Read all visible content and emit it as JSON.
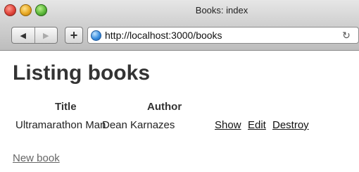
{
  "window": {
    "title": "Books: index"
  },
  "toolbar": {
    "back_icon": "back-arrow-icon",
    "forward_icon": "forward-arrow-icon",
    "add_label": "+",
    "url": "http://localhost:3000/books",
    "reload_icon": "reload-icon"
  },
  "page": {
    "heading": "Listing books",
    "table": {
      "headers": [
        "Title",
        "Author"
      ],
      "rows": [
        {
          "title": "Ultramarathon Man",
          "author": "Dean Karnazes",
          "actions": [
            "Show",
            "Edit",
            "Destroy"
          ]
        }
      ]
    },
    "new_link": "New book"
  },
  "colors": {
    "heading": "#333333",
    "link_muted": "#666666"
  }
}
